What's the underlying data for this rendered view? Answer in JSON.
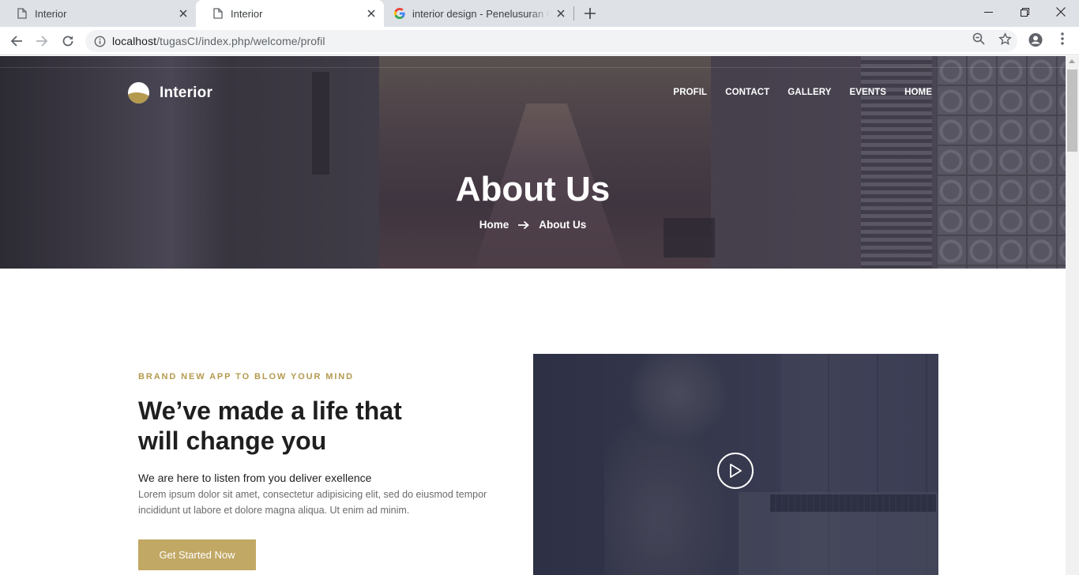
{
  "browser": {
    "tabs": [
      {
        "title": "Interior",
        "active": false,
        "icon": "page-icon"
      },
      {
        "title": "Interior",
        "active": true,
        "icon": "page-icon"
      },
      {
        "title": "interior design - Penelusuran Google",
        "active": false,
        "icon": "google-icon"
      }
    ],
    "url": {
      "host": "localhost",
      "path": "/tugasCI/index.php/welcome/profil"
    }
  },
  "site": {
    "brand": "Interior",
    "nav": [
      "PROFIL",
      "CONTACT",
      "GALLERY",
      "EVENTS",
      "HOME"
    ],
    "hero": {
      "title": "About Us",
      "breadcrumb_home": "Home",
      "breadcrumb_current": "About Us"
    },
    "intro": {
      "eyebrow": "BRAND NEW APP TO BLOW YOUR MIND",
      "headline": "We’ve made a life that will change you",
      "lead": "We are here to listen from you deliver exellence",
      "body": "Lorem ipsum dolor sit amet, consectetur adipisicing elit, sed do eiusmod tempor incididunt ut labore et dolore magna aliqua. Ut enim ad minim.",
      "cta": "Get Started Now"
    }
  },
  "colors": {
    "accent": "#c1a865",
    "eyebrow": "#b49a4f",
    "heading": "#1f1f1f"
  }
}
